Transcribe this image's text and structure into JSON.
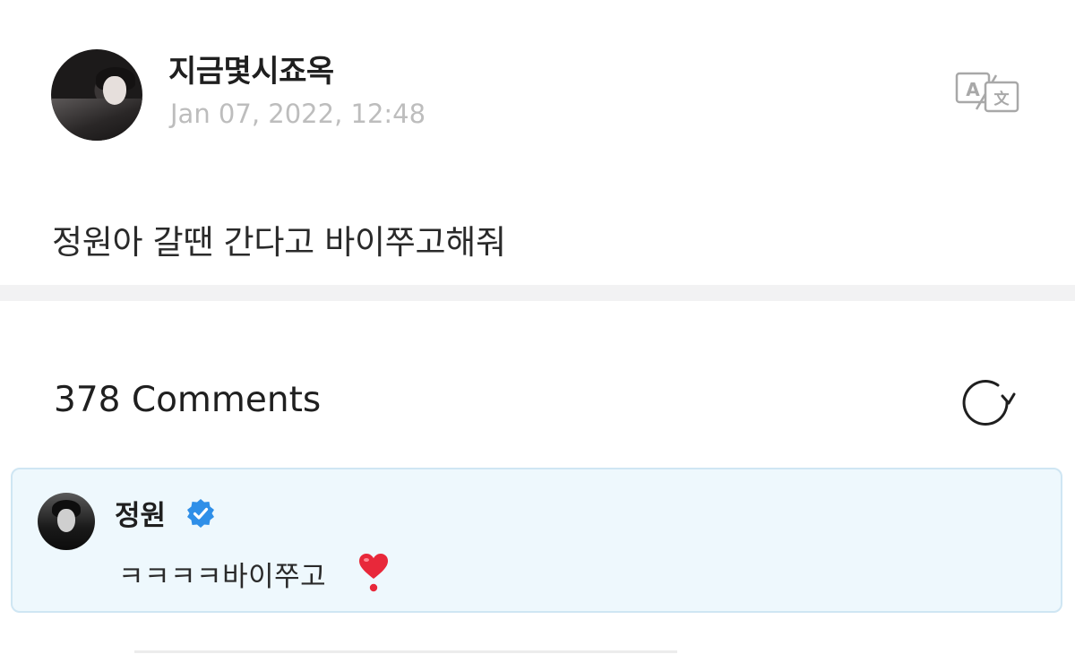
{
  "post": {
    "author": "지금몇시죠옥",
    "timestamp": "Jan 07, 2022, 12:48",
    "body": "정원아 갈땐 간다고 바이쭈고해줘",
    "translate_icon": "translate-icon"
  },
  "comments": {
    "count_label": "378 Comments",
    "refresh_icon": "refresh-icon",
    "highlighted": {
      "author": "정원",
      "verified": true,
      "text": "ㅋㅋㅋㅋ바이쭈고",
      "emoji_icon": "heart-exclamation-icon"
    }
  },
  "colors": {
    "highlight_bg": "#eef8fd",
    "highlight_border": "#cfe6f3",
    "verified_blue": "#2f8fe8",
    "heart_red": "#e8283a",
    "timestamp_gray": "#bdbdbd"
  }
}
